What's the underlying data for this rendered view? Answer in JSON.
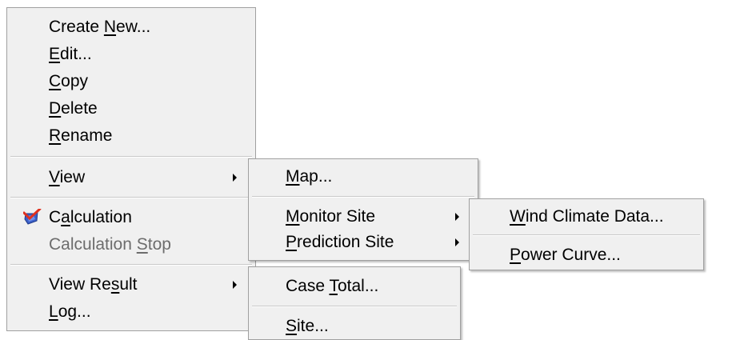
{
  "main_menu": {
    "items": [
      {
        "pre": "Create ",
        "key": "N",
        "post": "ew..."
      },
      {
        "pre": "",
        "key": "E",
        "post": "dit..."
      },
      {
        "pre": "",
        "key": "C",
        "post": "opy"
      },
      {
        "pre": "",
        "key": "D",
        "post": "elete"
      },
      {
        "pre": "",
        "key": "R",
        "post": "ename"
      },
      {
        "pre": "",
        "key": "V",
        "post": "iew"
      },
      {
        "pre": "C",
        "key": "a",
        "post": "lculation"
      },
      {
        "pre": "Calculation ",
        "key": "S",
        "post": "top"
      },
      {
        "pre": "View Re",
        "key": "s",
        "post": "ult"
      },
      {
        "pre": "",
        "key": "L",
        "post": "og..."
      }
    ]
  },
  "view_submenu": {
    "items": [
      {
        "pre": "",
        "key": "M",
        "post": "ap..."
      },
      {
        "pre": "",
        "key": "M",
        "post": "onitor Site"
      },
      {
        "pre": "",
        "key": "P",
        "post": "rediction Site"
      }
    ]
  },
  "monitor_site_submenu": {
    "items": [
      {
        "pre": "",
        "key": "W",
        "post": "ind Climate Data..."
      },
      {
        "pre": "",
        "key": "P",
        "post": "ower Curve..."
      }
    ]
  },
  "view_result_submenu": {
    "items": [
      {
        "pre": "Case ",
        "key": "T",
        "post": "otal..."
      },
      {
        "pre": "",
        "key": "S",
        "post": "ite..."
      }
    ]
  },
  "icons": {
    "calculation": "calculation-icon"
  },
  "colors": {
    "menu_bg": "#f0f0f0",
    "disabled_text": "#6d6d6d",
    "border": "#a0a0a0"
  }
}
